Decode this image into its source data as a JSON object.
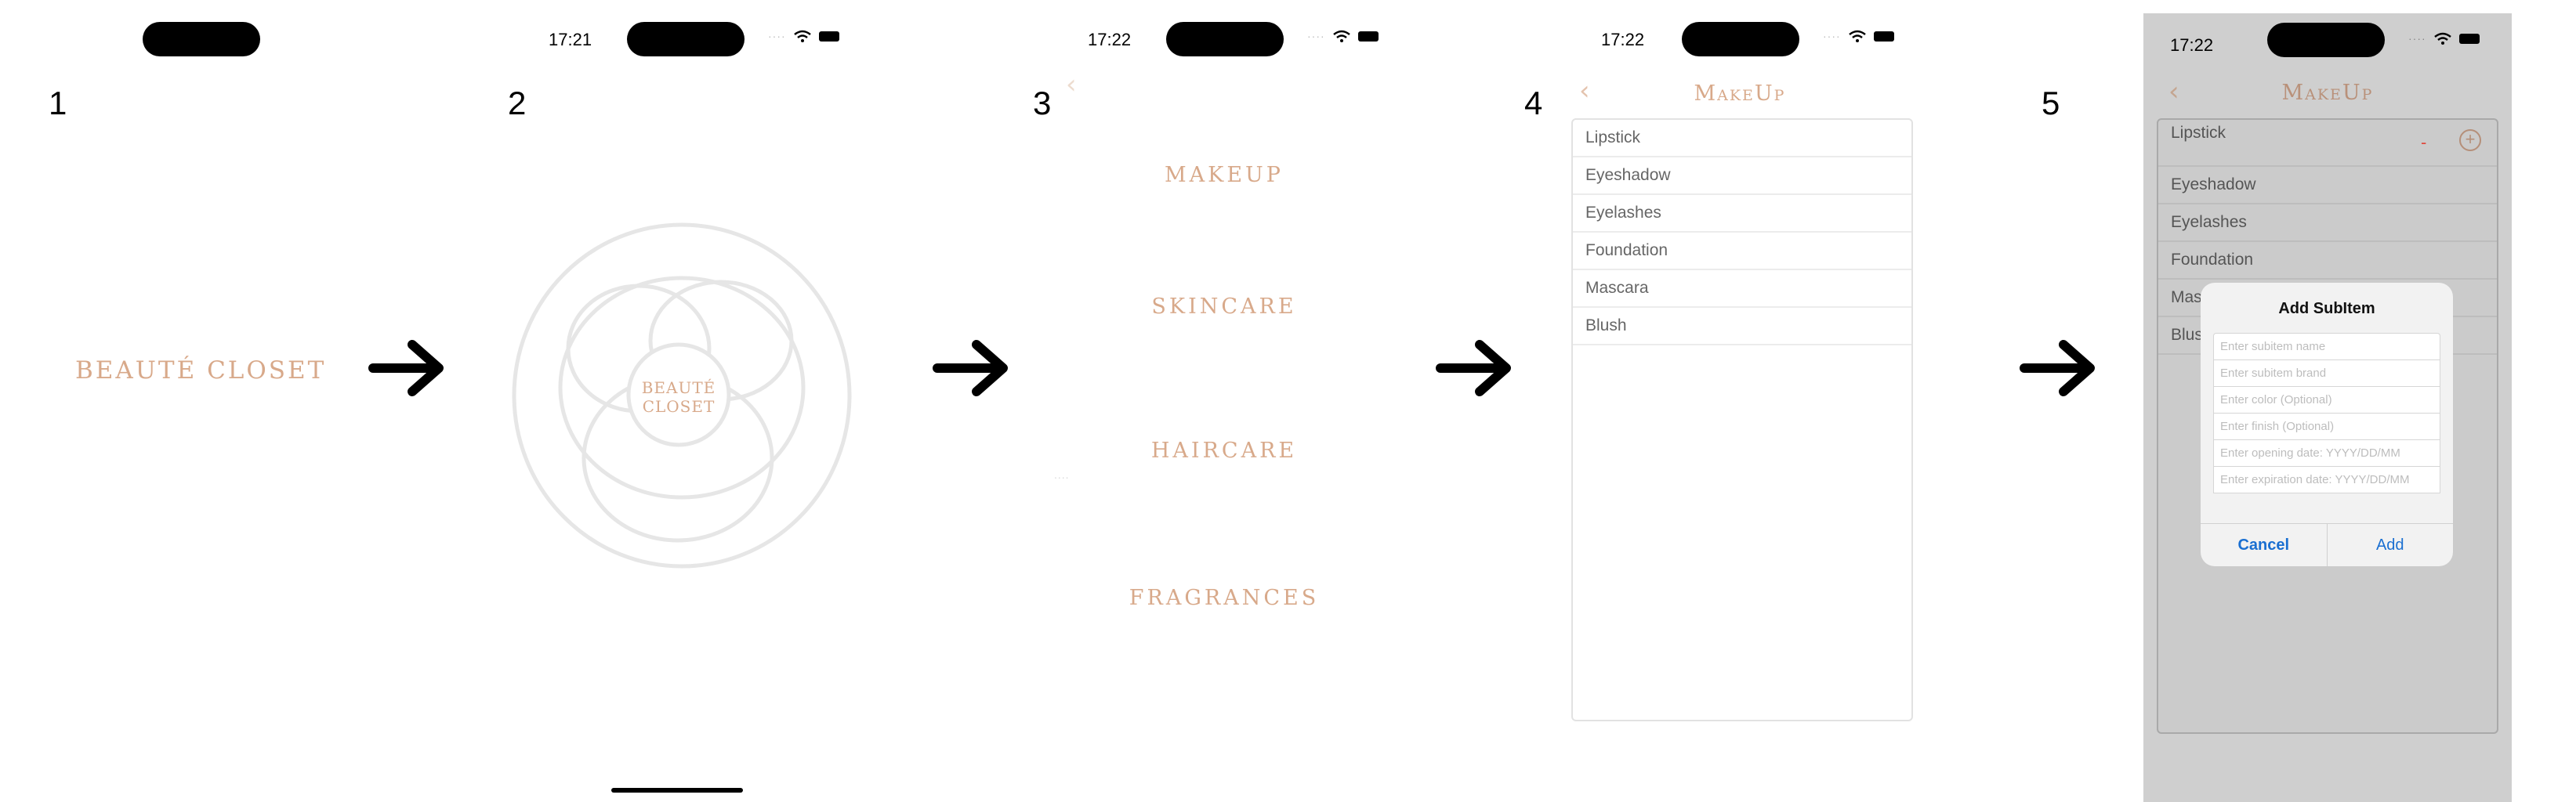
{
  "steps": [
    "1",
    "2",
    "3",
    "4",
    "5"
  ],
  "arrow": "→",
  "screen1": {
    "brand": "BEAUTÉ CLOSET"
  },
  "screen2": {
    "time": "17:21",
    "logo_line1": "BEAUTÉ",
    "logo_line2": "CLOSET"
  },
  "screen3": {
    "time": "17:22",
    "back": "‹",
    "categories": [
      "MAKEUP",
      "SKINCARE",
      "HAIRCARE",
      "FRAGRANCES"
    ],
    "dots": "...."
  },
  "screen4": {
    "time": "17:22",
    "back": "‹",
    "title": "MakeUp",
    "items": [
      "Lipstick",
      "Eyeshadow",
      "Eyelashes",
      "Foundation",
      "Mascara",
      "Blush"
    ]
  },
  "screen5": {
    "time": "17:22",
    "back": "‹",
    "title": "MakeUp",
    "items": [
      "Lipstick",
      "Eyeshadow",
      "Eyelashes",
      "Foundation",
      "Mas",
      "Blus"
    ],
    "minus": "-",
    "plus": "+",
    "dialog": {
      "title": "Add SubItem",
      "placeholders": [
        "Enter subitem name",
        "Enter subitem brand",
        "Enter color (Optional)",
        "Enter finish (Optional)",
        "Enter opening date: YYYY/DD/MM",
        "Enter expiration date: YYYY/DD/MM"
      ],
      "cancel": "Cancel",
      "add": "Add"
    }
  },
  "colors": {
    "accent": "#D8A98A",
    "link": "#1A6FD1",
    "minus": "#E0473C"
  }
}
